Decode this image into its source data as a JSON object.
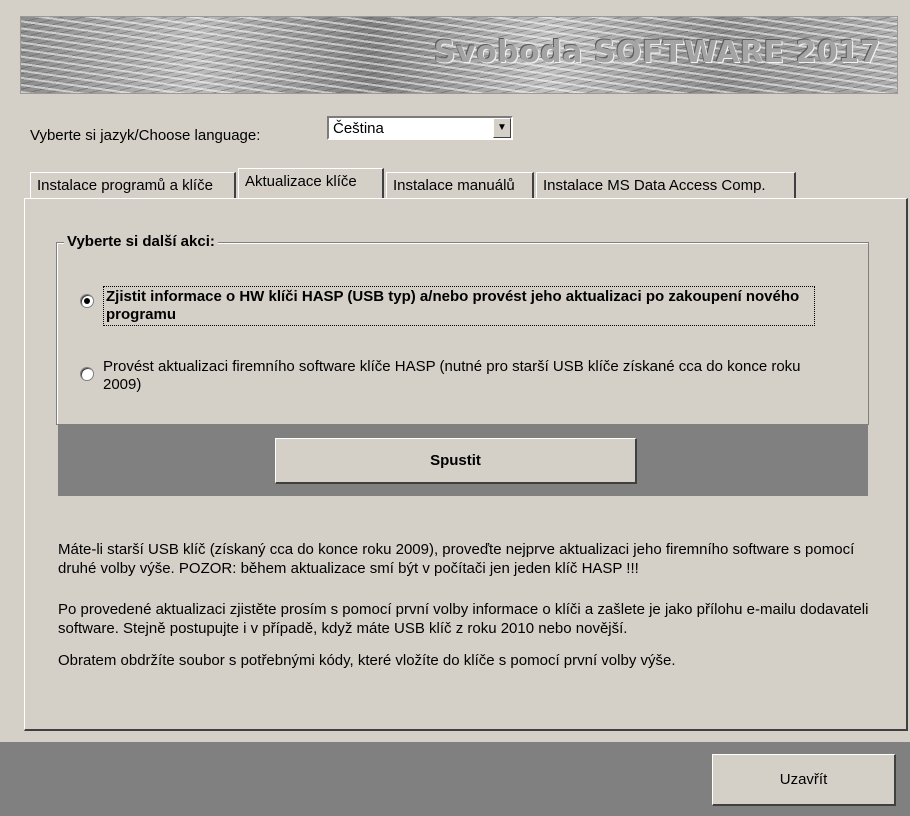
{
  "banner": {
    "title": "Svoboda SOFTWARE 2017"
  },
  "language": {
    "label": "Vyberte si jazyk/Choose language:",
    "selected": "Čeština"
  },
  "tabs": [
    {
      "label": "Instalace programů a klíče"
    },
    {
      "label": "Aktualizace klíče"
    },
    {
      "label": "Instalace manuálů"
    },
    {
      "label": "Instalace MS Data Access Comp."
    }
  ],
  "group": {
    "title": "Vyberte si další akci:",
    "option1": "Zjistit informace o HW klíči HASP (USB typ) a/nebo provést jeho aktualizaci po zakoupení nového programu",
    "option2": "Provést aktualizaci firemního software klíče HASP (nutné pro starší USB klíče získané cca do konce roku 2009)"
  },
  "run_button": "Spustit",
  "info": {
    "p1": "Máte-li starší USB klíč (získaný cca do konce roku 2009), proveďte nejprve aktualizaci jeho firemního software s pomocí druhé volby výše. POZOR: během aktualizace smí být v počítači jen jeden klíč HASP !!!",
    "p2": "Po provedené aktualizaci zjistěte prosím s pomocí první volby informace o klíči a zašlete je jako přílohu e-mailu dodavateli software. Stejně postupujte i v případě, když máte USB klíč z roku 2010 nebo novější.",
    "p3": "Obratem obdržíte soubor s potřebnými kódy, které vložíte do klíče s pomocí první volby výše."
  },
  "close_button": "Uzavřít"
}
